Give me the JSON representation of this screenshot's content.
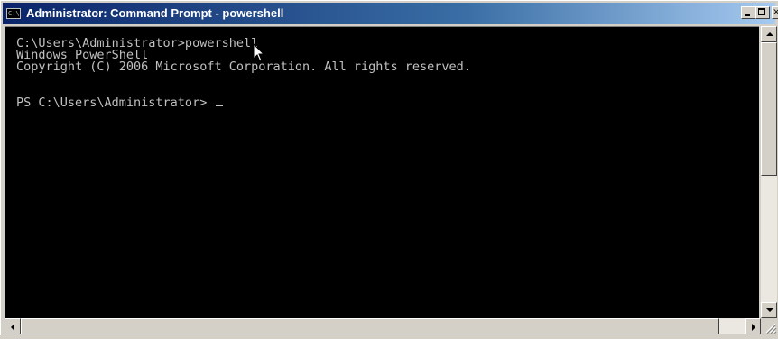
{
  "window": {
    "title": "Administrator: Command Prompt - powershell",
    "icon": "console-icon",
    "icon_text": "C:\\",
    "controls": {
      "minimize": "minimize-icon",
      "maximize": "maximize-icon",
      "close_label": "×"
    }
  },
  "console": {
    "lines": [
      "C:\\Users\\Administrator>powershell",
      "Windows PowerShell",
      "Copyright (C) 2006 Microsoft Corporation. All rights reserved.",
      "",
      "PS C:\\Users\\Administrator>"
    ],
    "background": "#000000",
    "foreground": "#c0c0c0"
  },
  "colors": {
    "titlebar_start": "#0a246a",
    "titlebar_end": "#a6caf0",
    "chrome": "#d4d0c8"
  }
}
